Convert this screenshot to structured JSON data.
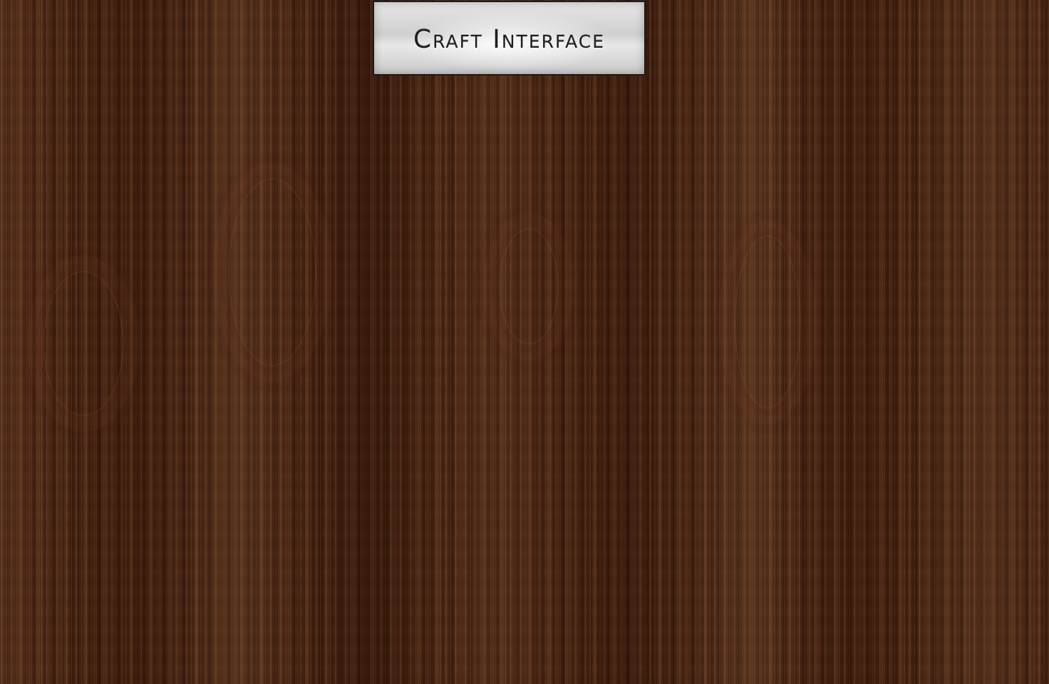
{
  "app": {
    "title": "Craft Interface"
  },
  "background": {
    "texture": "dark-walnut-wood-grain",
    "base_color": "#4d2815"
  },
  "title_plate": {
    "texture": "brushed-metal",
    "color": "#d9d9d9",
    "text_color": "#1f1f1f"
  }
}
